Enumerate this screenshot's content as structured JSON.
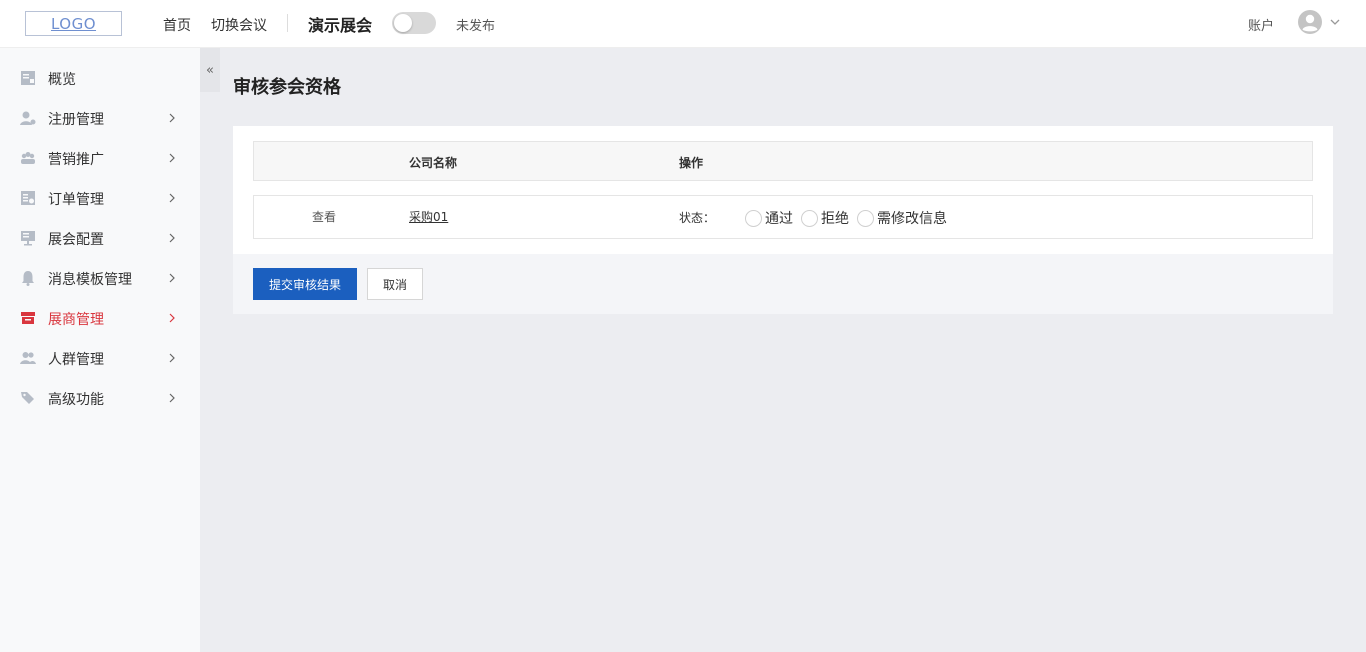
{
  "header": {
    "logo_text": "LOGO",
    "nav_home": "首页",
    "nav_switch": "切换会议",
    "event_name": "演示展会",
    "publish_status": "未发布",
    "account_label": "账户"
  },
  "sidebar": {
    "collapse_label": "«",
    "items": [
      {
        "label": "概览",
        "icon": "overview-icon",
        "has_arrow": false
      },
      {
        "label": "注册管理",
        "icon": "user-register-icon",
        "has_arrow": true
      },
      {
        "label": "营销推广",
        "icon": "group-icon",
        "has_arrow": true
      },
      {
        "label": "订单管理",
        "icon": "order-icon",
        "has_arrow": true
      },
      {
        "label": "展会配置",
        "icon": "monitor-icon",
        "has_arrow": true
      },
      {
        "label": "消息模板管理",
        "icon": "bell-icon",
        "has_arrow": true
      },
      {
        "label": "展商管理",
        "icon": "store-icon",
        "has_arrow": true,
        "active": true
      },
      {
        "label": "人群管理",
        "icon": "people-icon",
        "has_arrow": true
      },
      {
        "label": "高级功能",
        "icon": "tag-icon",
        "has_arrow": true
      }
    ]
  },
  "main": {
    "page_title": "审核参会资格",
    "table": {
      "headers": [
        "",
        "公司名称",
        "操作"
      ],
      "rows": [
        {
          "view": "查看",
          "company": "采购01",
          "status_label": "状态：",
          "options": [
            "通过",
            "拒绝",
            "需修改信息"
          ]
        }
      ]
    },
    "submit_button": "提交审核结果",
    "cancel_button": "取消"
  },
  "colors": {
    "primary": "#1b5fbf",
    "active_menu": "#d9363e",
    "background": "#ecedf1"
  }
}
